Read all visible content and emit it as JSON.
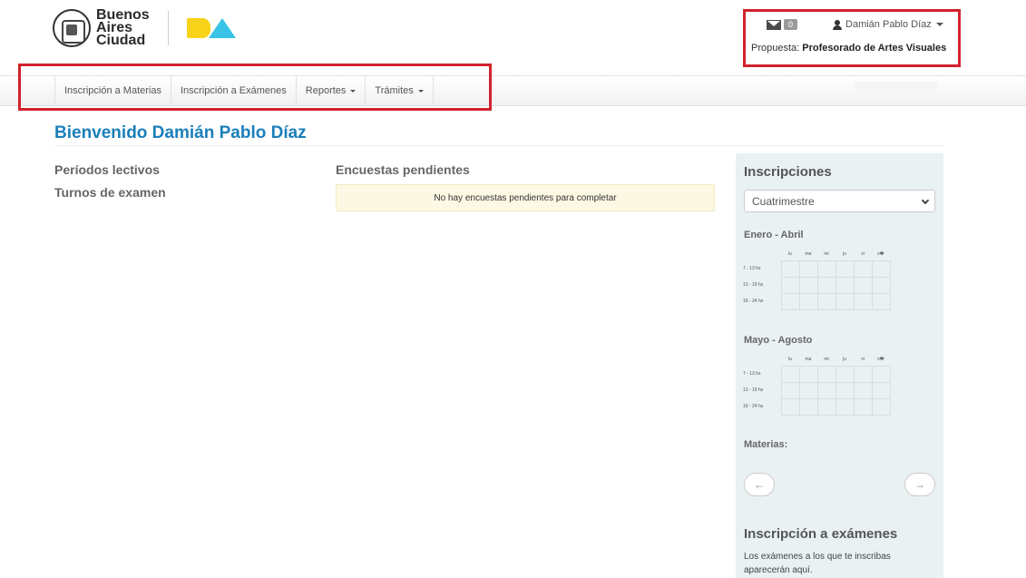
{
  "header": {
    "city_logo_text": [
      "Buenos",
      "Aires",
      "Ciudad"
    ],
    "ba_logo_text": "BA",
    "messages_count": "0",
    "user_name": "Damián Pablo Díaz",
    "propuesta_label": "Propuesta:",
    "propuesta_value": "Profesorado de Artes Visuales"
  },
  "nav": {
    "items": [
      {
        "label": "Inscripción a Materias",
        "has_caret": false
      },
      {
        "label": "Inscripción a Exámenes",
        "has_caret": false
      },
      {
        "label": "Reportes",
        "has_caret": true
      },
      {
        "label": "Trámites",
        "has_caret": true
      }
    ]
  },
  "main": {
    "welcome": "Bienvenido Damián Pablo Díaz",
    "left_links": [
      "Períodos lectivos",
      "Turnos de examen"
    ],
    "encuestas_title": "Encuestas pendientes",
    "encuestas_notice": "No hay encuestas pendientes para completar"
  },
  "sidebar": {
    "inscripciones_title": "Inscripciones",
    "period_select": "Cuatrimestre",
    "schedules": [
      {
        "title": "Enero - Abril"
      },
      {
        "title": "Mayo - Agosto"
      }
    ],
    "days": [
      "lu",
      "ma",
      "mi",
      "ju",
      "vi",
      "s�"
    ],
    "time_slots": [
      "7 - 13 hs",
      "13 - 19 hs",
      "19 - 24 hs"
    ],
    "materias_label": "Materias:",
    "prev_arrow": "←",
    "next_arrow": "→",
    "examenes_title": "Inscripción a exámenes",
    "examenes_text": "Los exámenes a los que te inscribas aparecerán aquí."
  },
  "colors": {
    "accent": "#1a7fb9",
    "highlight_border": "#d1222d",
    "notice_bg": "#fcf8e3",
    "sidebar_bg": "#e9f1f3",
    "ba_yellow": "#f7d31a",
    "ba_cyan": "#39c3e6"
  },
  "icons": {
    "messages": "envelope-icon",
    "user": "user-icon",
    "seal": "city-seal-icon"
  }
}
